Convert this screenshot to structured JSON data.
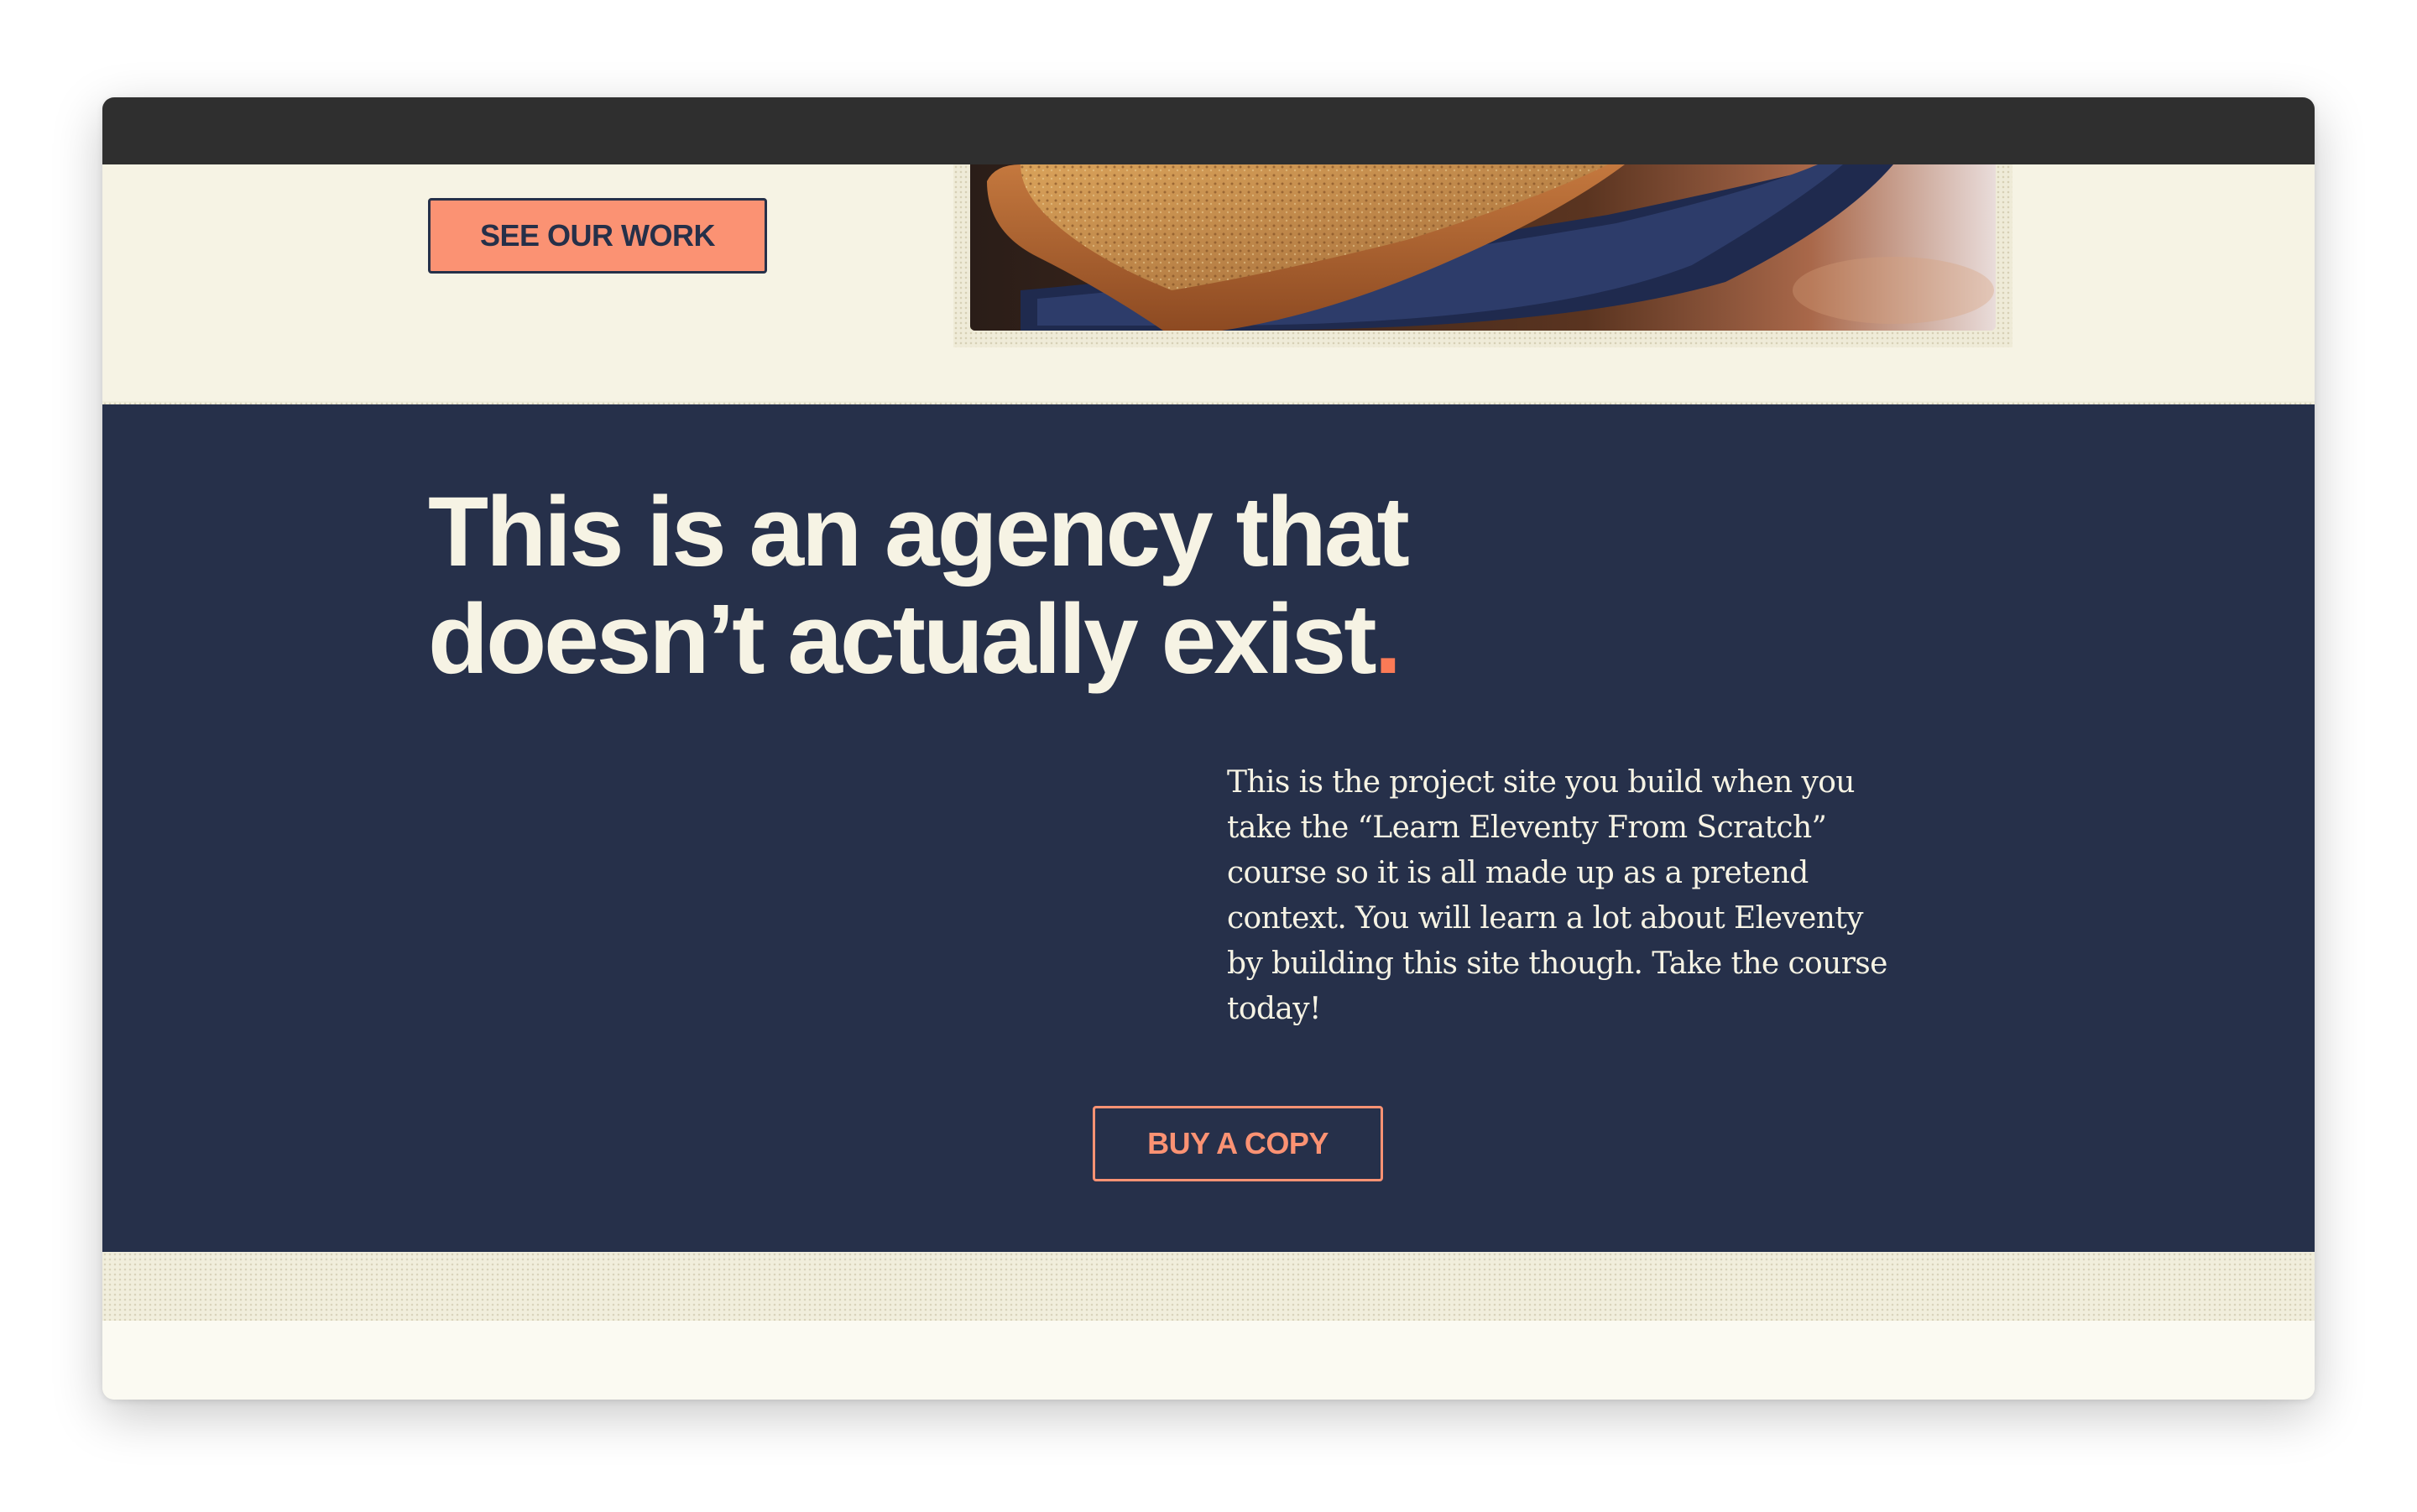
{
  "hero": {
    "cta_label": "SEE OUR WORK",
    "image_alt": "french-toast-photo"
  },
  "about": {
    "headline_main": "This is an agency that doesn’t actually exist",
    "headline_dot": ".",
    "intro": "This is the project site you build when you take the “Learn Eleventy From Scratch” course so it is all made up as a pretend context. You will learn a lot about Eleventy by building this site though. Take the course today!",
    "cta_label": "BUY A COPY"
  },
  "colors": {
    "accent": "#fb9273",
    "dark": "#26304a",
    "light": "#f6f3e4"
  }
}
